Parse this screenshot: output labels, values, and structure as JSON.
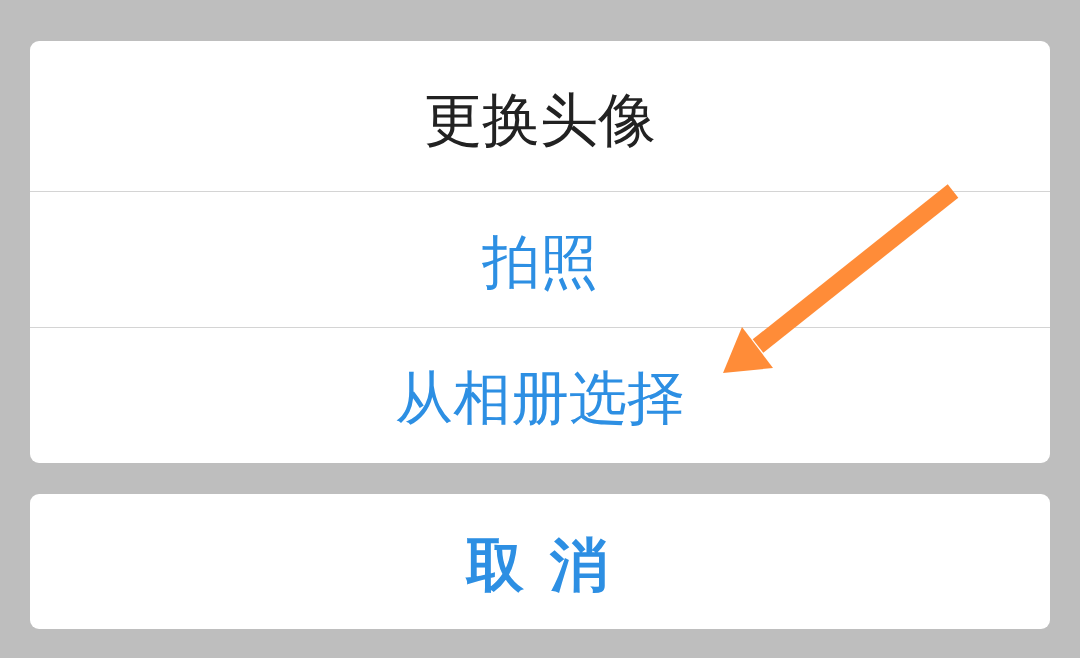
{
  "action_sheet": {
    "title": "更换头像",
    "options": [
      {
        "label": "拍照"
      },
      {
        "label": "从相册选择"
      }
    ]
  },
  "cancel_button": {
    "label": "取 消"
  }
}
